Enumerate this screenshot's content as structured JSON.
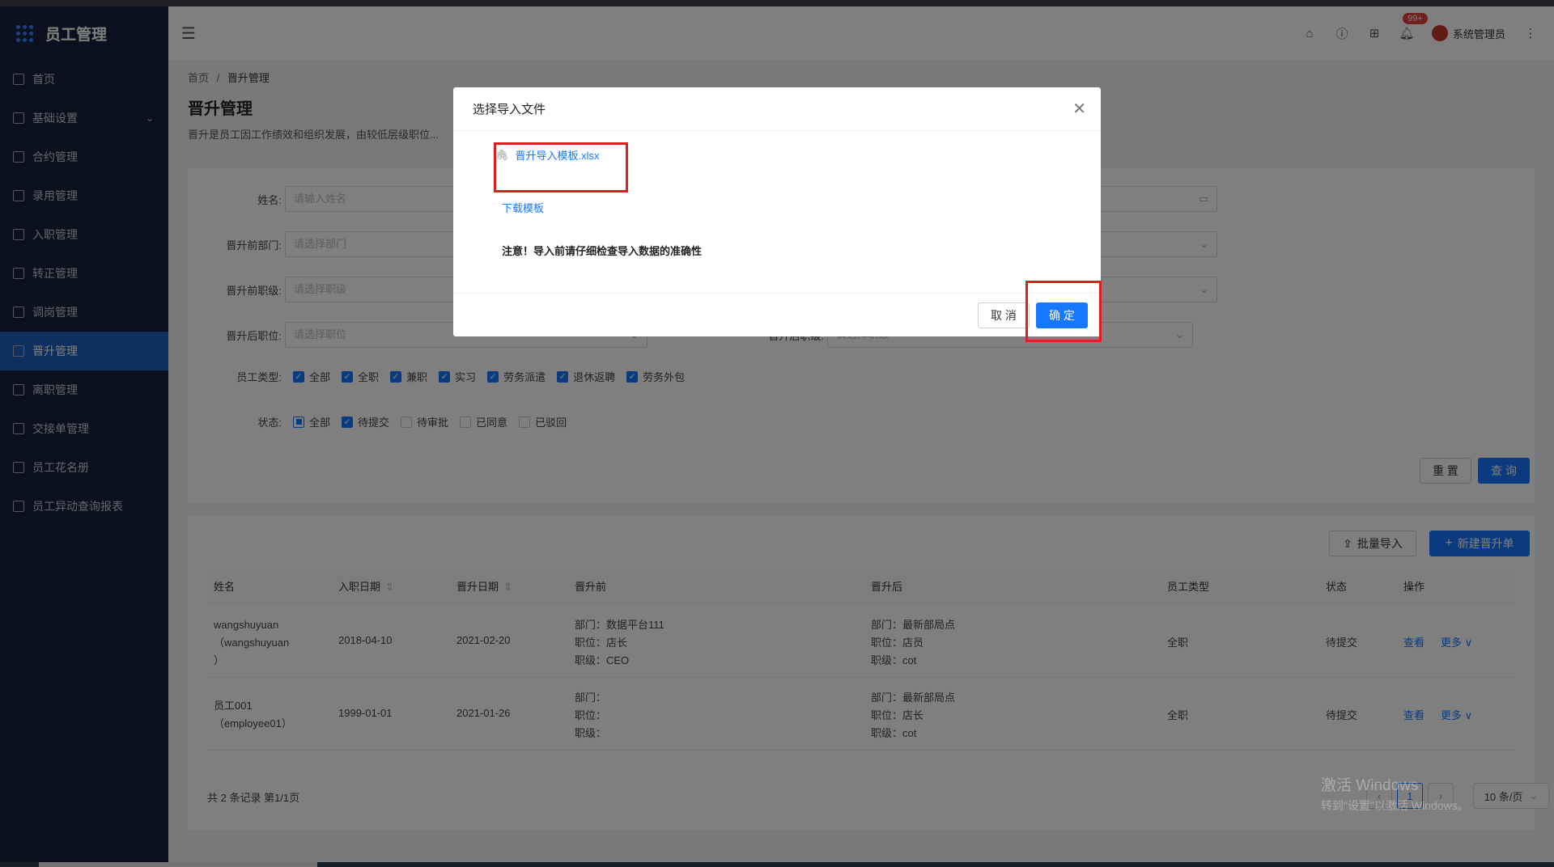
{
  "app": {
    "title": "员工管理"
  },
  "sidebar": {
    "items": [
      {
        "label": "首页"
      },
      {
        "label": "基础设置"
      },
      {
        "label": "合约管理"
      },
      {
        "label": "录用管理"
      },
      {
        "label": "入职管理"
      },
      {
        "label": "转正管理"
      },
      {
        "label": "调岗管理"
      },
      {
        "label": "晋升管理"
      },
      {
        "label": "离职管理"
      },
      {
        "label": "交接单管理"
      },
      {
        "label": "员工花名册"
      },
      {
        "label": "员工异动查询报表"
      }
    ]
  },
  "header": {
    "badge": "99+",
    "user": "系统管理员"
  },
  "breadcrumb": {
    "home": "首页",
    "sep": "/",
    "current": "晋升管理"
  },
  "page": {
    "title": "晋升管理",
    "desc": "晋升是员工因工作绩效和组织发展，由较低层级职位..."
  },
  "filter": {
    "name_label": "姓名:",
    "name_ph": "请输入姓名",
    "dept_label": "晋升前部门:",
    "dept_ph": "请选择部门",
    "rank_label": "晋升前职级:",
    "rank_ph": "请选择职级",
    "pos_label": "晋升后职位:",
    "pos_ph": "请选择职位",
    "rank_after_label": "晋升后职级:",
    "rank_after_ph": "请选择职级",
    "emptype_label": "员工类型:",
    "emptypes": [
      {
        "label": "全部",
        "state": "checked"
      },
      {
        "label": "全职",
        "state": "checked"
      },
      {
        "label": "兼职",
        "state": "checked"
      },
      {
        "label": "实习",
        "state": "checked"
      },
      {
        "label": "劳务派遣",
        "state": "checked"
      },
      {
        "label": "退休返聘",
        "state": "checked"
      },
      {
        "label": "劳务外包",
        "state": "checked"
      }
    ],
    "status_label": "状态:",
    "statuses": [
      {
        "label": "全部",
        "state": "indeterminate"
      },
      {
        "label": "待提交",
        "state": "checked"
      },
      {
        "label": "待审批",
        "state": "unchecked"
      },
      {
        "label": "已同意",
        "state": "unchecked"
      },
      {
        "label": "已驳回",
        "state": "unchecked"
      }
    ],
    "reset": "重 置",
    "query": "查 询"
  },
  "table": {
    "import_btn": "批量导入",
    "new_btn": "新建晋升单",
    "columns": [
      "姓名",
      "入职日期",
      "晋升日期",
      "晋升前",
      "晋升后",
      "员工类型",
      "状态",
      "操作"
    ],
    "rows": [
      {
        "name": "wangshuyuan",
        "name2": "（wangshuyuan",
        "name3": "）",
        "join": "2018-04-10",
        "promo": "2021-02-20",
        "before": [
          "部门：数据平台111",
          "职位：店长",
          "职级：CEO"
        ],
        "after": [
          "部门：最新部局点",
          "职位：店员",
          "职级：cot"
        ],
        "type": "全职",
        "status": "待提交",
        "view": "查看",
        "more": "更多 ∨"
      },
      {
        "name": "员工001",
        "name2": "（employee01）",
        "name3": "",
        "join": "1999-01-01",
        "promo": "2021-01-26",
        "before": [
          "部门：",
          "职位：",
          "职级："
        ],
        "after": [
          "部门：最新部局点",
          "职位：店长",
          "职级：cot"
        ],
        "type": "全职",
        "status": "待提交",
        "view": "查看",
        "more": "更多 ∨"
      }
    ],
    "total": "共 2 条记录 第1/1页",
    "page": "1",
    "page_size": "10 条/页"
  },
  "modal": {
    "title": "选择导入文件",
    "file": "晋升导入模板.xlsx",
    "download": "下载模板",
    "note": "注意！导入前请仔细检查导入数据的准确性",
    "cancel": "取 消",
    "ok": "确 定"
  },
  "watermark": {
    "line1": "激活 Windows",
    "line2": "转到\"设置\"以激活 Windows。"
  }
}
